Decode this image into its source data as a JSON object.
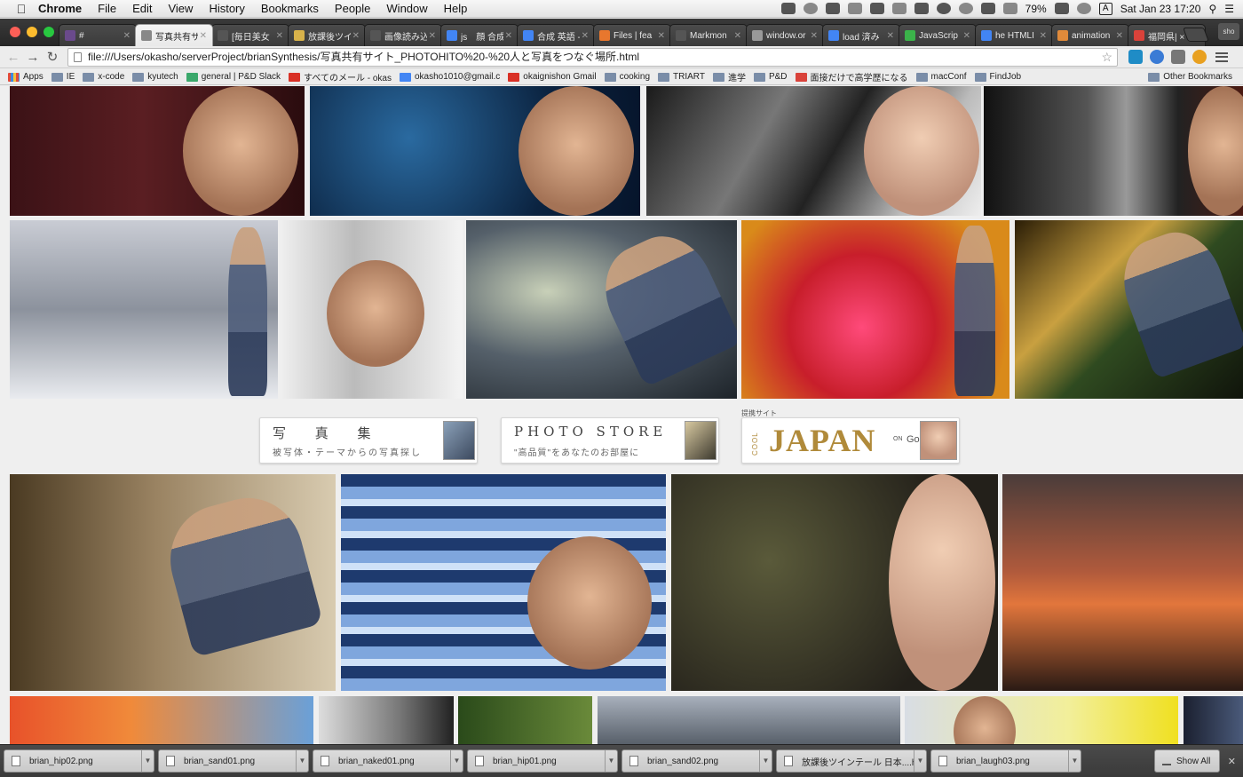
{
  "menubar": {
    "app": "Chrome",
    "items": [
      "File",
      "Edit",
      "View",
      "History",
      "Bookmarks",
      "People",
      "Window",
      "Help"
    ],
    "battery": "79%",
    "input_source": "A",
    "datetime": "Sat Jan 23  17:20"
  },
  "tabs": [
    {
      "label": "#",
      "favicon_color": "#6a4a8c"
    },
    {
      "label": "写真共有サ",
      "favicon_color": "#888888",
      "active": true
    },
    {
      "label": "[毎日美女",
      "favicon_color": "#555555"
    },
    {
      "label": "放課後ツイ",
      "favicon_color": "#d8b24a"
    },
    {
      "label": "画像読み込",
      "favicon_color": "#555555"
    },
    {
      "label": "js　顔 合成",
      "favicon_color": "#4285f4"
    },
    {
      "label": "合成 英語 -",
      "favicon_color": "#4285f4"
    },
    {
      "label": "Files | fea",
      "favicon_color": "#e8772e"
    },
    {
      "label": "Markmon",
      "favicon_color": "#555555"
    },
    {
      "label": "window.or",
      "favicon_color": "#999999"
    },
    {
      "label": "load 済み",
      "favicon_color": "#4285f4"
    },
    {
      "label": "JavaScrip",
      "favicon_color": "#3bb34a"
    },
    {
      "label": "he HTMLI",
      "favicon_color": "#4285f4"
    },
    {
      "label": "animation",
      "favicon_color": "#e08a3a"
    },
    {
      "label": "福岡県| ×",
      "favicon_color": "#d9423a"
    }
  ],
  "profile": "sho",
  "address_bar": {
    "url": "file:///Users/okasho/serverProject/brianSynthesis/写真共有サイト_PHOTOHITO%20-%20人と写真をつなぐ場所.html"
  },
  "bookmarks": [
    {
      "label": "Apps",
      "type": "apps"
    },
    {
      "label": "IE",
      "type": "folder"
    },
    {
      "label": "x-code",
      "type": "folder"
    },
    {
      "label": "kyutech",
      "type": "folder"
    },
    {
      "label": "general | P&D Slack",
      "type": "page",
      "color": "#3aa86b"
    },
    {
      "label": "すべてのメール - okas",
      "type": "page",
      "color": "#d93025"
    },
    {
      "label": "okasho1010@gmail.c",
      "type": "page",
      "color": "#4285f4"
    },
    {
      "label": "okaignishon Gmail",
      "type": "page",
      "color": "#d93025"
    },
    {
      "label": "cooking",
      "type": "folder"
    },
    {
      "label": "TRIART",
      "type": "folder"
    },
    {
      "label": "進学",
      "type": "folder"
    },
    {
      "label": "P&D",
      "type": "folder"
    },
    {
      "label": "面接だけで高学歴になる",
      "type": "page",
      "color": "#d9423a"
    },
    {
      "label": "macConf",
      "type": "folder"
    },
    {
      "label": "FindJob",
      "type": "folder"
    }
  ],
  "other_bookmarks": "Other Bookmarks",
  "banners": [
    {
      "title": "写 真 集",
      "subtitle": "被写体・テーマからの写真探し"
    },
    {
      "title": "PHOTO STORE",
      "subtitle": "\"高品質\"をあなたのお部屋に"
    }
  ],
  "sponsor_label": "提携サイト",
  "cool_japan": {
    "cool": "COOL",
    "title": "JAPAN",
    "on": "ON",
    "goo": "Goo"
  },
  "downloads": [
    {
      "name": "brian_hip02.png"
    },
    {
      "name": "brian_sand01.png"
    },
    {
      "name": "brian_naked01.png"
    },
    {
      "name": "brian_hip01.png"
    },
    {
      "name": "brian_sand02.png"
    },
    {
      "name": "放課後ツインテール 日本....html"
    },
    {
      "name": "brian_laugh03.png"
    }
  ],
  "show_all": "Show All",
  "colors": {
    "chrome_dark": "#2e2e2e",
    "bookmark_folder": "#7a8da8",
    "cool_japan_gold": "#b08a3a"
  }
}
